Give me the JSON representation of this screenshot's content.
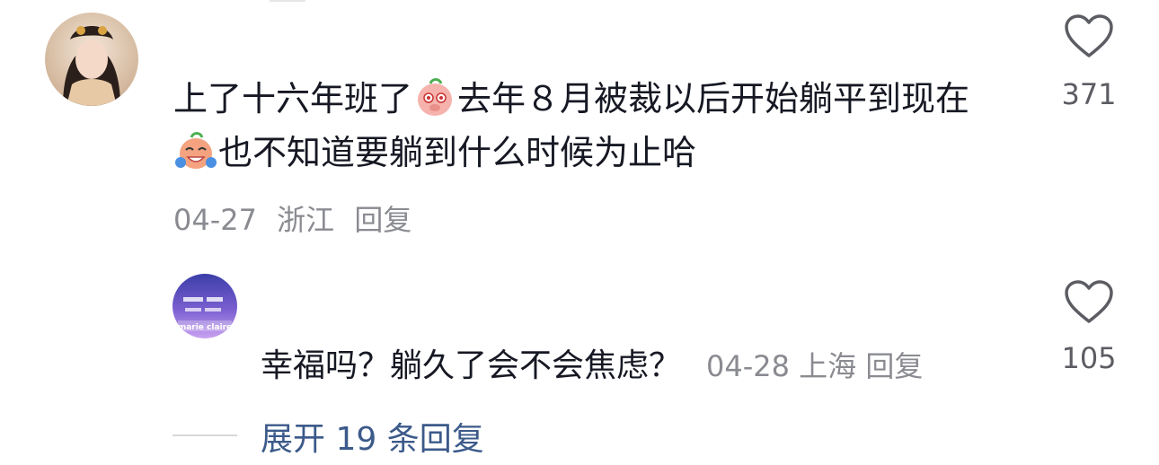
{
  "comment": {
    "text_part1": "上了十六年班了",
    "text_part2": "去年８月被裁以后开始躺平到现在",
    "text_part3": "也不知道要躺到什么时候为止哈",
    "date": "04-27",
    "location": "浙江",
    "reply_label": "回复",
    "like_count": "371",
    "emoji1": "pleading-face-emoji",
    "emoji2": "laughing-tears-emoji"
  },
  "reply": {
    "avatar_text": "marie claire",
    "text": "幸福吗？躺久了会不会焦虑？",
    "date": "04-28",
    "location": "上海",
    "reply_label": "回复",
    "like_count": "105"
  },
  "expand": {
    "label": "展开 19 条回复"
  },
  "colors": {
    "text": "#161823",
    "meta": "#8a8b91",
    "link": "#3c5a8a"
  }
}
